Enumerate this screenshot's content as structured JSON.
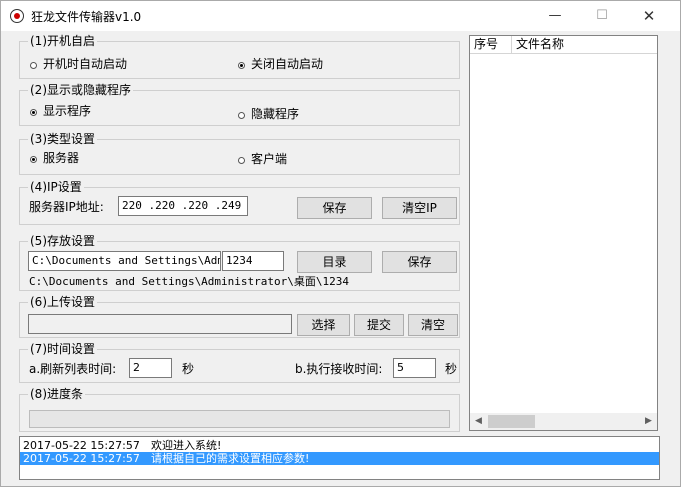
{
  "window": {
    "title": "狂龙文件传输器v1.0",
    "minimize_glyph": "—",
    "maximize_glyph": "☐",
    "close_glyph": "✕"
  },
  "autostart": {
    "legend": "(1)开机自启",
    "option_on": "开机时自动启动",
    "option_off": "关闭自动启动",
    "selected": "option_off"
  },
  "display": {
    "legend": "(2)显示或隐藏程序",
    "option_show": "显示程序",
    "option_hide": "隐藏程序",
    "selected": "option_show"
  },
  "type": {
    "legend": "(3)类型设置",
    "option_server": "服务器",
    "option_client": "客户端",
    "selected": "option_server"
  },
  "ip": {
    "legend": "(4)IP设置",
    "label": "服务器IP地址:",
    "value": "220 .220 .220 .249",
    "save_label": "保存",
    "clear_label": "清空IP"
  },
  "storage": {
    "legend": "(5)存放设置",
    "path_value": "C:\\Documents and Settings\\Admini",
    "name_value": "1234",
    "dir_label": "目录",
    "save_label": "保存",
    "full_path": "C:\\Documents and Settings\\Administrator\\桌面\\1234"
  },
  "upload": {
    "legend": "(6)上传设置",
    "path_value": "",
    "select_label": "选择",
    "submit_label": "提交",
    "clear_label": "清空"
  },
  "timing": {
    "legend": "(7)时间设置",
    "refresh_label": "a.刷新列表时间:",
    "refresh_value": "2",
    "refresh_unit": "秒",
    "receive_label": "b.执行接收时间:",
    "receive_value": "5",
    "receive_unit": "秒"
  },
  "progress": {
    "legend": "(8)进度条",
    "value": 0
  },
  "file_list": {
    "columns": [
      "序号",
      "文件名称"
    ],
    "rows": []
  },
  "log": {
    "entries": [
      {
        "time": "2017-05-22 15:27:57",
        "message": "欢迎进入系统!",
        "selected": false
      },
      {
        "time": "2017-05-22 15:27:57",
        "message": "请根据自己的需求设置相应参数!",
        "selected": true
      }
    ]
  },
  "colors": {
    "selection": "#3399ff",
    "window_bg": "#f0f0f0"
  }
}
